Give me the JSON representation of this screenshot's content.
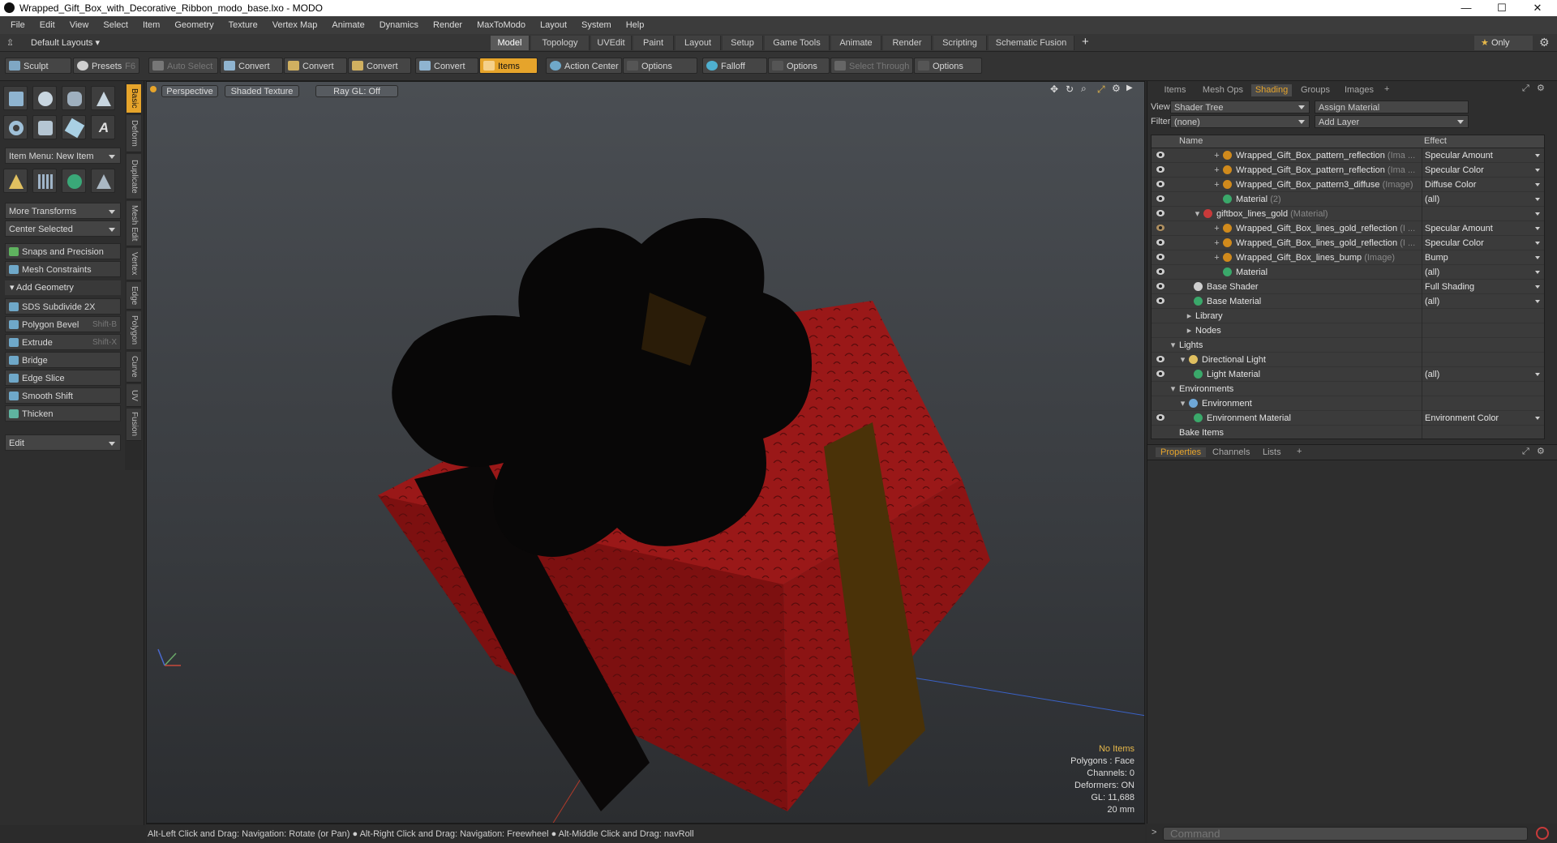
{
  "window": {
    "title": "Wrapped_Gift_Box_with_Decorative_Ribbon_modo_base.lxo - MODO",
    "controls": [
      "—",
      "☐",
      "✕"
    ]
  },
  "menu": [
    "File",
    "Edit",
    "View",
    "Select",
    "Item",
    "Geometry",
    "Texture",
    "Vertex Map",
    "Animate",
    "Dynamics",
    "Render",
    "MaxToModo",
    "Layout",
    "System",
    "Help"
  ],
  "layout_bar": {
    "preset": "Default Layouts",
    "tabs": [
      "Model",
      "Topology",
      "UVEdit",
      "Paint",
      "Layout",
      "Setup",
      "Game Tools",
      "Animate",
      "Render",
      "Scripting",
      "Schematic Fusion"
    ],
    "active_tab": "Model",
    "add": "+",
    "only": "Only"
  },
  "toolbar": {
    "sculpt": "Sculpt",
    "presets": "Presets",
    "presets_key": "F6",
    "auto_select": "Auto Select",
    "convert1": "Convert",
    "convert2": "Convert",
    "convert3": "Convert",
    "convert4": "Convert",
    "items": "Items",
    "action_center": "Action Center",
    "options1": "Options",
    "falloff": "Falloff",
    "options2": "Options",
    "select_through": "Select Through",
    "options3": "Options"
  },
  "left_panel": {
    "vertical_tabs": [
      "Basic",
      "Deform",
      "Duplicate",
      "Mesh Edit",
      "Vertex",
      "Edge",
      "Polygon",
      "Curve",
      "UV",
      "Fusion"
    ],
    "item_menu": "Item Menu: New Item",
    "more_transforms": "More Transforms",
    "center_selected": "Center Selected",
    "snaps": "Snaps and Precision",
    "mesh_constraints": "Mesh Constraints",
    "add_geometry": "Add Geometry",
    "tools": [
      {
        "label": "SDS Subdivide 2X",
        "shortcut": ""
      },
      {
        "label": "Polygon Bevel",
        "shortcut": "Shift-B"
      },
      {
        "label": "Extrude",
        "shortcut": "Shift-X"
      },
      {
        "label": "Bridge",
        "shortcut": ""
      },
      {
        "label": "Edge Slice",
        "shortcut": ""
      },
      {
        "label": "Smooth Shift",
        "shortcut": ""
      },
      {
        "label": "Thicken",
        "shortcut": ""
      }
    ],
    "edit": "Edit"
  },
  "viewport": {
    "view_mode": "Perspective",
    "shading": "Shaded Texture",
    "raygl": "Ray GL: Off",
    "stats": {
      "items": "No Items",
      "polygons": "Polygons : Face",
      "channels": "Channels: 0",
      "deformers": "Deformers: ON",
      "gl": "GL: 11,688",
      "scale": "20 mm"
    }
  },
  "status": "Alt-Left Click and Drag: Navigation: Rotate (or Pan) ● Alt-Right Click and Drag: Navigation: Freewheel ● Alt-Middle Click and Drag: navRoll",
  "command_placeholder": "Command",
  "right_panel": {
    "tabs": [
      "Items",
      "Mesh Ops",
      "Shading",
      "Groups",
      "Images"
    ],
    "active_tab": "Shading",
    "view_label": "View",
    "view_value": "Shader Tree",
    "assign_material": "Assign Material",
    "filter_label": "Filter",
    "filter_value": "(none)",
    "add_layer": "Add Layer",
    "col_name": "Name",
    "col_effect": "Effect",
    "rows": [
      {
        "name": "Wrapped_Gift_Box_pattern_reflection",
        "sub": "(Ima ...",
        "effect": "Specular Amount"
      },
      {
        "name": "Wrapped_Gift_Box_pattern_reflection",
        "sub": "(Ima ...",
        "effect": "Specular Color"
      },
      {
        "name": "Wrapped_Gift_Box_pattern3_diffuse",
        "sub": "(Image)",
        "effect": "Diffuse Color"
      },
      {
        "name": "Material",
        "sub": "(2)",
        "effect": "(all)"
      },
      {
        "name": "giftbox_lines_gold",
        "sub": "(Material)",
        "effect": ""
      },
      {
        "name": "Wrapped_Gift_Box_lines_gold_reflection",
        "sub": "(I ...",
        "effect": "Specular Amount"
      },
      {
        "name": "Wrapped_Gift_Box_lines_gold_reflection",
        "sub": "(I ...",
        "effect": "Specular Color"
      },
      {
        "name": "Wrapped_Gift_Box_lines_bump",
        "sub": "(Image)",
        "effect": "Bump"
      },
      {
        "name": "Material",
        "sub": "",
        "effect": "(all)"
      },
      {
        "name": "Base Shader",
        "sub": "",
        "effect": "Full Shading"
      },
      {
        "name": "Base Material",
        "sub": "",
        "effect": "(all)"
      },
      {
        "name": "Library",
        "sub": "",
        "effect": ""
      },
      {
        "name": "Nodes",
        "sub": "",
        "effect": ""
      },
      {
        "name": "Lights",
        "sub": "",
        "effect": ""
      },
      {
        "name": "Directional Light",
        "sub": "",
        "effect": ""
      },
      {
        "name": "Light Material",
        "sub": "",
        "effect": "(all)"
      },
      {
        "name": "Environments",
        "sub": "",
        "effect": ""
      },
      {
        "name": "Environment",
        "sub": "",
        "effect": ""
      },
      {
        "name": "Environment Material",
        "sub": "",
        "effect": "Environment Color"
      },
      {
        "name": "Bake Items",
        "sub": "",
        "effect": ""
      }
    ],
    "bottom_tabs": [
      "Properties",
      "Channels",
      "Lists"
    ],
    "bottom_active": "Properties"
  }
}
